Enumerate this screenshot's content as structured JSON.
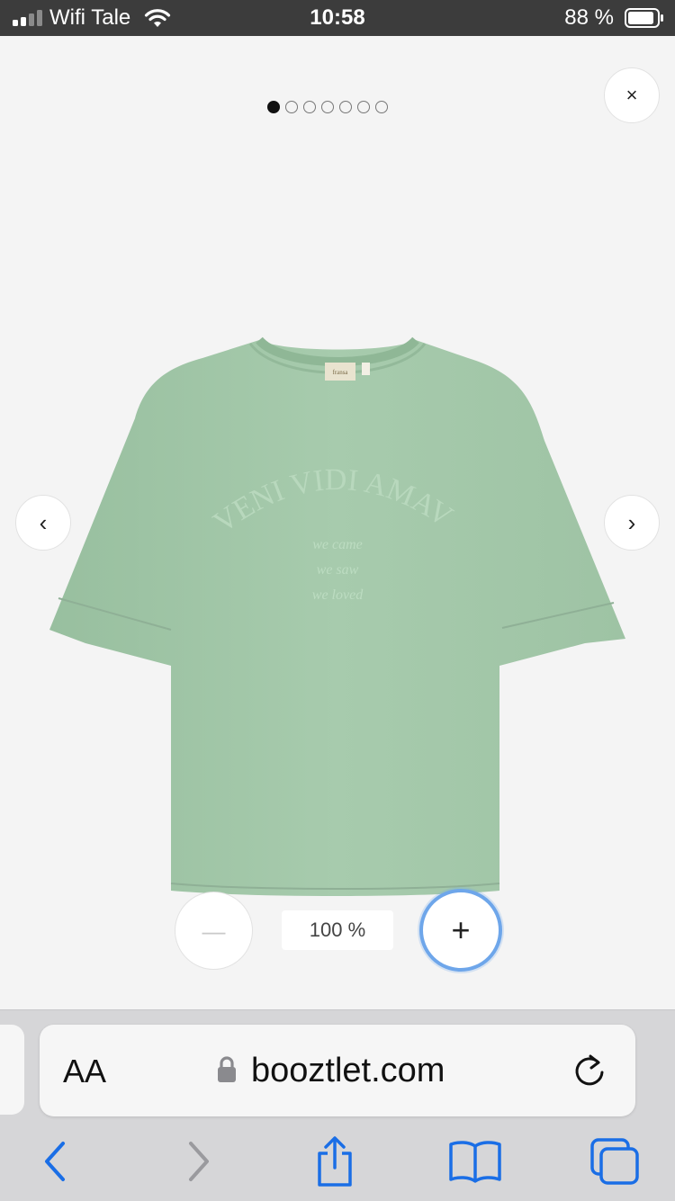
{
  "status_bar": {
    "carrier": "Wifi Tale",
    "time": "10:58",
    "battery": "88 %",
    "icons": [
      "signal-icon",
      "wifi-icon",
      "battery-icon"
    ]
  },
  "gallery": {
    "dot_count": 7,
    "active_index": 0,
    "close_symbol": "×",
    "prev_symbol": "‹",
    "next_symbol": "›",
    "product": {
      "label": "fransa",
      "print_headline": "VENI VIDI AMAVI",
      "print_lines": [
        "we came",
        "we saw",
        "we loved"
      ],
      "color": "#a2c6a8"
    }
  },
  "zoom": {
    "out_symbol": "—",
    "in_symbol": "+",
    "level": "100 %"
  },
  "browser": {
    "text_size_label": "AA",
    "url": "booztlet.com",
    "accent": "#1a6ee6"
  }
}
